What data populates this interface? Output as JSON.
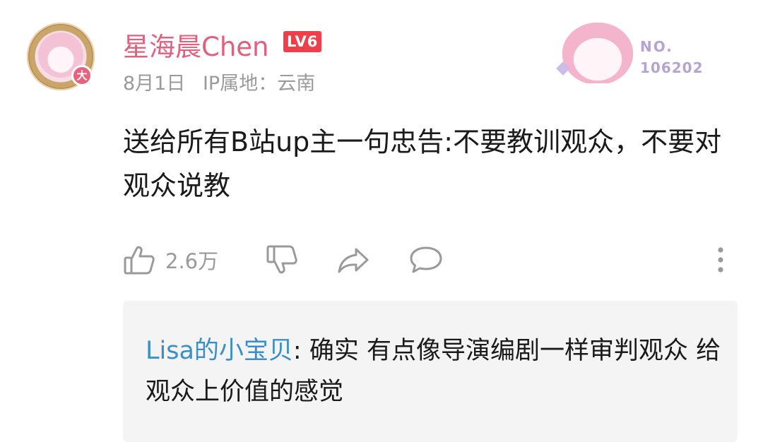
{
  "comment": {
    "username": "星海晨Chen",
    "level_badge": "LV6",
    "avatar_badge": "大",
    "date": "8月1日",
    "ip_location": "IP属地：云南",
    "text": "送给所有B站up主一句忠告:不要教训观众，不要对观众说教",
    "like_count": "2.6万"
  },
  "fan_badge": {
    "no_label": "NO.",
    "no_value": "106202"
  },
  "reply": {
    "author": "Lisa的小宝贝",
    "separator": ": ",
    "text": "确实 有点像导演编剧一样审判观众 给观众上价值的感觉"
  },
  "colors": {
    "username": "#e0607e",
    "level_badge_bg": "#ee3f4a",
    "meta_text": "#9a9a9a",
    "reply_author": "#3a8fc9",
    "reply_bg": "#f4f4f5"
  }
}
